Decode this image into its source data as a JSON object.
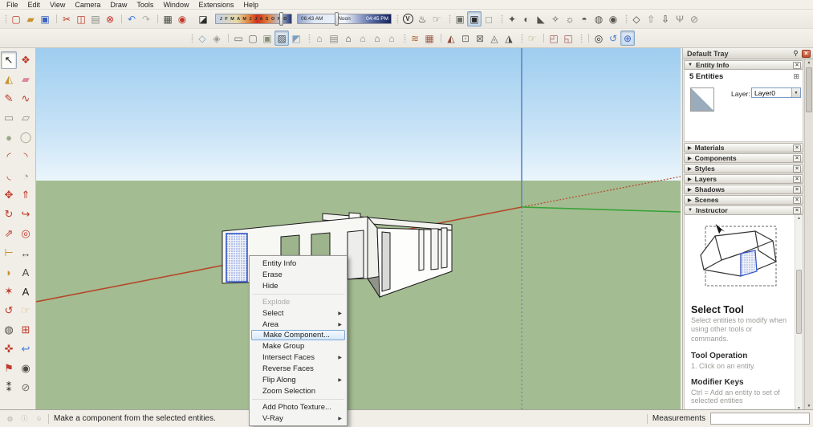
{
  "menu_bar": {
    "items": [
      {
        "label": "File",
        "name": "menu-file"
      },
      {
        "label": "Edit",
        "name": "menu-edit"
      },
      {
        "label": "View",
        "name": "menu-view"
      },
      {
        "label": "Camera",
        "name": "menu-camera"
      },
      {
        "label": "Draw",
        "name": "menu-draw"
      },
      {
        "label": "Tools",
        "name": "menu-tools"
      },
      {
        "label": "Window",
        "name": "menu-window"
      },
      {
        "label": "Extensions",
        "name": "menu-extensions"
      },
      {
        "label": "Help",
        "name": "menu-help"
      }
    ]
  },
  "toolbar1": {
    "standard": [
      {
        "name": "new-button",
        "glyph": "▢",
        "color": "#c0392b"
      },
      {
        "name": "open-button",
        "glyph": "▰",
        "color": "#c8912e"
      },
      {
        "name": "save-button",
        "glyph": "▣",
        "color": "#3b62c4"
      },
      {
        "name": "cut-button",
        "glyph": "✂",
        "color": "#c0392b",
        "classes": "divider-before"
      },
      {
        "name": "copy-button",
        "glyph": "◫",
        "color": "#c0392b"
      },
      {
        "name": "paste-button",
        "glyph": "▤",
        "color": "#8a8a86"
      },
      {
        "name": "erase-button",
        "glyph": "⊗",
        "color": "#cc2b2b"
      },
      {
        "name": "undo-button",
        "glyph": "↶",
        "color": "#4a7fd4",
        "classes": "divider-before"
      },
      {
        "name": "redo-button",
        "glyph": "↷",
        "color": "#b0b0ac"
      },
      {
        "name": "print-button",
        "glyph": "▦",
        "color": "#4a4a46",
        "classes": "divider-before"
      },
      {
        "name": "model-info-button",
        "glyph": "◉",
        "color": "#c0392b"
      }
    ],
    "shadows": {
      "toggle_glyph": "◪",
      "months": "J F M A M J J A S O N D",
      "time_start": "06:43 AM",
      "time_noon": "Noon",
      "time_end": "04:45 PM"
    },
    "vray_main": [
      {
        "name": "vray-asset-editor-button",
        "glyph": "V",
        "color": "#2b2b2b",
        "classes": "ring"
      },
      {
        "name": "vray-render-button",
        "glyph": "♨",
        "color": "#2b2b2b"
      },
      {
        "name": "vray-interactive-render-button",
        "glyph": "☞",
        "color": "#6b6b67"
      }
    ],
    "vray_fb": [
      {
        "name": "vray-frame-buffer-button",
        "glyph": "▣",
        "color": "#6b6b67"
      },
      {
        "name": "vray-batch-render-button",
        "glyph": "▣",
        "color": "#2b2b2b",
        "classes": "pressed"
      },
      {
        "name": "vray-lock-camera-button",
        "glyph": "◻",
        "color": "#a0a09a"
      }
    ],
    "vray_lights": [
      {
        "name": "vray-dome-light-button",
        "glyph": "✦",
        "color": "#55524e"
      },
      {
        "name": "vray-sphere-light-button",
        "glyph": "◐",
        "color": "#55524e"
      },
      {
        "name": "vray-spot-light-button",
        "glyph": "◣",
        "color": "#55524e"
      },
      {
        "name": "vray-ies-light-button",
        "glyph": "✧",
        "color": "#55524e"
      },
      {
        "name": "vray-omni-light-button",
        "glyph": "☼",
        "color": "#55524e"
      },
      {
        "name": "vray-rectangle-light-button",
        "glyph": "◓",
        "color": "#55524e"
      },
      {
        "name": "vray-mesh-light-button",
        "glyph": "◍",
        "color": "#55524e"
      },
      {
        "name": "vray-light-gen-button",
        "glyph": "◉",
        "color": "#55524e"
      }
    ],
    "vray_utils": [
      {
        "name": "vray-infinite-plane-button",
        "glyph": "◇",
        "color": "#44413d"
      },
      {
        "name": "vray-export-proxy-button",
        "glyph": "⇧",
        "color": "#8a8a86"
      },
      {
        "name": "vray-import-proxy-button",
        "glyph": "⇩",
        "color": "#44413d"
      },
      {
        "name": "vray-fur-button",
        "glyph": "Ψ",
        "color": "#8a8a86"
      },
      {
        "name": "vray-clipper-button",
        "glyph": "⊘",
        "color": "#8a8a86"
      }
    ]
  },
  "toolbar2": {
    "face_styles": [
      {
        "name": "xray-mode-button",
        "glyph": "◇",
        "color": "#7da0c0"
      },
      {
        "name": "back-edges-button",
        "glyph": "◈",
        "color": "#9a9a96"
      },
      {
        "name": "wireframe-button",
        "glyph": "▭",
        "color": "#6b6b67",
        "classes": "divider-before"
      },
      {
        "name": "hidden-line-button",
        "glyph": "▢",
        "color": "#6b6b67"
      },
      {
        "name": "shaded-button",
        "glyph": "▣",
        "color": "#8a8f7a"
      },
      {
        "name": "shaded-with-textures-button",
        "glyph": "▨",
        "color": "#4a4a46",
        "classes": "pressed"
      },
      {
        "name": "monochrome-button",
        "glyph": "◩",
        "color": "#7da0c0"
      }
    ],
    "views": [
      {
        "name": "iso-view-button",
        "glyph": "⌂",
        "color": "#8a8f7a"
      },
      {
        "name": "top-view-button",
        "glyph": "▤",
        "color": "#8a8a86"
      },
      {
        "name": "front-view-button",
        "glyph": "⌂",
        "color": "#4a4a46"
      },
      {
        "name": "right-view-button",
        "glyph": "⌂",
        "color": "#8a8a86"
      },
      {
        "name": "back-view-button",
        "glyph": "⌂",
        "color": "#6b6b67"
      },
      {
        "name": "left-view-button",
        "glyph": "⌂",
        "color": "#8a8a86"
      }
    ],
    "sandbox": [
      {
        "name": "sandbox-from-contours-button",
        "glyph": "≋",
        "color": "#b06a3a"
      },
      {
        "name": "sandbox-from-scratch-button",
        "glyph": "▦",
        "color": "#9a5a4a"
      },
      {
        "name": "smoove-button",
        "glyph": "◭",
        "color": "#8a4a3a",
        "classes": "divider-before"
      },
      {
        "name": "stamp-button",
        "glyph": "⊡",
        "color": "#6b6b67"
      },
      {
        "name": "drape-button",
        "glyph": "⊠",
        "color": "#6b6b67"
      },
      {
        "name": "add-detail-button",
        "glyph": "◬",
        "color": "#6b6b67"
      },
      {
        "name": "flip-edge-button",
        "glyph": "◮",
        "color": "#4a4a46"
      }
    ],
    "nav_section": [
      {
        "name": "hand-tool-button",
        "glyph": "☞",
        "color": "#b09a6a"
      },
      {
        "name": "section-plane-button",
        "glyph": "◰",
        "color": "#a05a5a",
        "classes": "divider-before"
      },
      {
        "name": "section-display-button",
        "glyph": "◱",
        "color": "#a05a5a"
      }
    ],
    "camera": [
      {
        "name": "look-around-button",
        "glyph": "◎",
        "color": "#2b2b2b",
        "classes": "divider-before"
      },
      {
        "name": "orbit-button",
        "glyph": "↺",
        "color": "#4a7fd4"
      },
      {
        "name": "orbit-globe-button",
        "glyph": "⊕",
        "color": "#3b62c4",
        "classes": "pressed"
      }
    ]
  },
  "left_toolbar": {
    "tools": [
      {
        "name": "select-tool-button",
        "glyph": "↖",
        "color": "#1a1a1a",
        "classes": "pressed"
      },
      {
        "name": "make-component-button",
        "glyph": "❖",
        "color": "#c0392b"
      },
      {
        "name": "paint-bucket-button",
        "glyph": "◭",
        "color": "#c8912e"
      },
      {
        "name": "eraser-button",
        "glyph": "▰",
        "color": "#d88aa0"
      },
      {
        "name": "line-tool-button",
        "glyph": "✎",
        "color": "#c0392b"
      },
      {
        "name": "freehand-tool-button",
        "glyph": "∿",
        "color": "#c0392b"
      },
      {
        "name": "rectangle-tool-button",
        "glyph": "▭",
        "color": "#8a8f7a"
      },
      {
        "name": "rotated-rectangle-tool-button",
        "glyph": "▱",
        "color": "#8a8f7a"
      },
      {
        "name": "circle-tool-button",
        "glyph": "●",
        "color": "#9aa88a"
      },
      {
        "name": "polygon-tool-button",
        "glyph": "◯",
        "color": "#9aa88a"
      },
      {
        "name": "arc-tool-button",
        "glyph": "◜",
        "color": "#c0392b"
      },
      {
        "name": "two-point-arc-tool-button",
        "glyph": "◝",
        "color": "#c0392b"
      },
      {
        "name": "three-point-arc-tool-button",
        "glyph": "◟",
        "color": "#c0392b"
      },
      {
        "name": "pie-tool-button",
        "glyph": "◔",
        "color": "#9aa88a"
      },
      {
        "name": "move-tool-button",
        "glyph": "✥",
        "color": "#c0392b"
      },
      {
        "name": "push-pull-tool-button",
        "glyph": "⇑",
        "color": "#c0392b"
      },
      {
        "name": "rotate-tool-button",
        "glyph": "↻",
        "color": "#c0392b"
      },
      {
        "name": "follow-me-tool-button",
        "glyph": "↪",
        "color": "#c0392b"
      },
      {
        "name": "scale-tool-button",
        "glyph": "⇗",
        "color": "#c0392b"
      },
      {
        "name": "offset-tool-button",
        "glyph": "◎",
        "color": "#c0392b"
      },
      {
        "name": "tape-measure-tool-button",
        "glyph": "⊢",
        "color": "#c8912e"
      },
      {
        "name": "dimension-tool-button",
        "glyph": "↔",
        "color": "#4a4a46"
      },
      {
        "name": "protractor-tool-button",
        "glyph": "◗",
        "color": "#c8912e"
      },
      {
        "name": "text-tool-button",
        "glyph": "A",
        "color": "#4a4a46"
      },
      {
        "name": "axes-tool-button",
        "glyph": "✶",
        "color": "#c0392b"
      },
      {
        "name": "3d-text-tool-button",
        "glyph": "A",
        "color": "#1a1a1a"
      },
      {
        "name": "orbit-tool-button",
        "glyph": "↺",
        "color": "#c0392b"
      },
      {
        "name": "pan-tool-button",
        "glyph": "☞",
        "color": "#d8b06a"
      },
      {
        "name": "zoom-tool-button",
        "glyph": "◍",
        "color": "#4a4a46"
      },
      {
        "name": "zoom-window-tool-button",
        "glyph": "⊞",
        "color": "#c0392b"
      },
      {
        "name": "zoom-extents-tool-button",
        "glyph": "✜",
        "color": "#c0392b"
      },
      {
        "name": "previous-view-tool-button",
        "glyph": "↩",
        "color": "#4a7fd4"
      },
      {
        "name": "position-camera-tool-button",
        "glyph": "⚑",
        "color": "#c0392b"
      },
      {
        "name": "look-around-tool-button",
        "glyph": "◉",
        "color": "#4a4a46"
      },
      {
        "name": "walk-tool-button",
        "glyph": "⁑",
        "color": "#1a1a1a"
      },
      {
        "name": "section-plane-tool-button",
        "glyph": "⊘",
        "color": "#6b6b67"
      }
    ]
  },
  "viewport": {
    "sky_top": "#9ecdef",
    "sky_horizon": "#eef8fd",
    "ground": "#a4bc92",
    "axis_red": "#b5482a",
    "axis_green": "#37a337",
    "axis_blue": "#5b87c5",
    "selection_blue": "#2f52c8"
  },
  "context_menu": {
    "items": [
      {
        "label": "Entity Info",
        "arrow": "",
        "classes": "",
        "name": "menu-item-entity-info"
      },
      {
        "label": "Erase",
        "arrow": "",
        "classes": "",
        "name": "menu-item-erase"
      },
      {
        "label": "Hide",
        "arrow": "",
        "classes": "",
        "name": "menu-item-hide"
      },
      {
        "label": "Explode",
        "arrow": "",
        "classes": "disabled sep-before",
        "name": "menu-item-explode"
      },
      {
        "label": "Select",
        "arrow": "▶",
        "classes": "",
        "name": "menu-item-select"
      },
      {
        "label": "Area",
        "arrow": "▶",
        "classes": "",
        "name": "menu-item-area"
      },
      {
        "label": "Make Component...",
        "arrow": "",
        "classes": "highlighted",
        "name": "menu-item-make-component"
      },
      {
        "label": "Make Group",
        "arrow": "",
        "classes": "",
        "name": "menu-item-make-group"
      },
      {
        "label": "Intersect Faces",
        "arrow": "▶",
        "classes": "",
        "name": "menu-item-intersect-faces"
      },
      {
        "label": "Reverse Faces",
        "arrow": "",
        "classes": "",
        "name": "menu-item-reverse-faces"
      },
      {
        "label": "Flip Along",
        "arrow": "▶",
        "classes": "",
        "name": "menu-item-flip-along"
      },
      {
        "label": "Zoom Selection",
        "arrow": "",
        "classes": "",
        "name": "menu-item-zoom-selection"
      },
      {
        "label": "Add Photo Texture...",
        "arrow": "",
        "classes": "sep-before",
        "name": "menu-item-add-photo-texture"
      },
      {
        "label": "V-Ray",
        "arrow": "▶",
        "classes": "",
        "name": "menu-item-vray"
      }
    ]
  },
  "tray": {
    "title": "Default Tray",
    "close_glyph": "×",
    "entity_info": {
      "arrow": "▼",
      "header": "Entity Info",
      "close": "×",
      "count": "5 Entities",
      "details_glyph": "⊞",
      "layer_label": "Layer:",
      "layer_value": "Layer0",
      "dropdown_glyph": "▼"
    },
    "sections": [
      {
        "label": "Materials",
        "name": "section-header-materials",
        "arrow": "▶",
        "close": "×"
      },
      {
        "label": "Components",
        "name": "section-header-components",
        "arrow": "▶",
        "close": "×"
      },
      {
        "label": "Styles",
        "name": "section-header-styles",
        "arrow": "▶",
        "close": "×"
      },
      {
        "label": "Layers",
        "name": "section-header-layers",
        "arrow": "▶",
        "close": "×"
      },
      {
        "label": "Shadows",
        "name": "section-header-shadows",
        "arrow": "▶",
        "close": "×"
      },
      {
        "label": "Scenes",
        "name": "section-header-scenes",
        "arrow": "▶",
        "close": "×"
      }
    ],
    "instructor": {
      "arrow": "▼",
      "header": "Instructor",
      "close": "×",
      "title": "Select Tool",
      "description": "Select entities to modify when using other tools or commands.",
      "operation_heading": "Tool Operation",
      "operation_step": "1.   Click on an entity.",
      "modifier_heading": "Modifier Keys",
      "modifier_text": "Ctrl = Add an entity to set of selected entities",
      "scroll_up": "▲",
      "scroll_down": "▼"
    },
    "tray_scroll_up": "▲",
    "tray_scroll_down": "▼"
  },
  "status_bar": {
    "icons": [
      {
        "name": "geolocation-icon",
        "glyph": "◍"
      },
      {
        "name": "credits-icon",
        "glyph": "ⓘ"
      },
      {
        "name": "claim-credit-icon",
        "glyph": "☺"
      }
    ],
    "message": "Make a component from the selected entities.",
    "measurements_label": "Measurements",
    "measurements_value": ""
  }
}
